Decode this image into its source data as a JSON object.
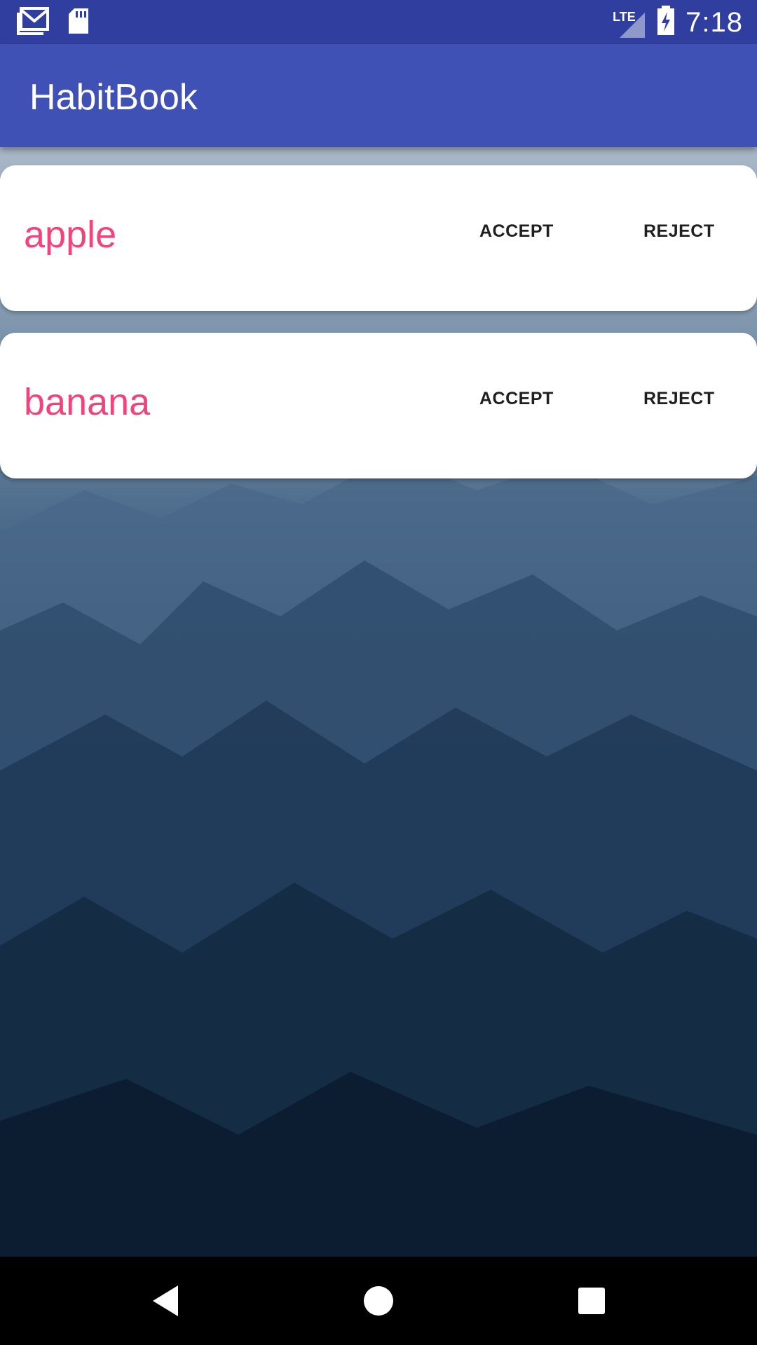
{
  "status_bar": {
    "time": "7:18",
    "network": "LTE",
    "icons": [
      "gmail-icon",
      "sd-card-icon",
      "signal-icon",
      "battery-charging-icon"
    ]
  },
  "app_bar": {
    "title": "HabitBook"
  },
  "requests": [
    {
      "name": "apple",
      "accept_label": "ACCEPT",
      "reject_label": "REJECT"
    },
    {
      "name": "banana",
      "accept_label": "ACCEPT",
      "reject_label": "REJECT"
    }
  ],
  "nav_bar": {
    "icons": [
      "back-icon",
      "home-icon",
      "recents-icon"
    ]
  },
  "colors": {
    "status_bar": "#303f9f",
    "app_bar": "#3f51b5",
    "name_accent": "#f0447a",
    "card": "#ffffff",
    "nav_bar": "#000000"
  }
}
